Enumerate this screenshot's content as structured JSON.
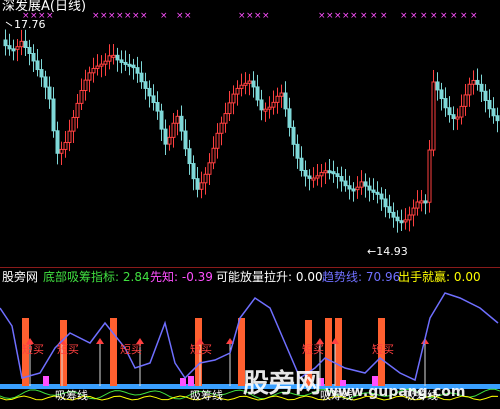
{
  "chart_title": "深发展A(日线)",
  "price": {
    "high_label": "17.76",
    "low_label": "←14.93",
    "markers_row": [
      "×",
      "×",
      "×",
      "×",
      "×",
      "×",
      "×",
      "×"
    ],
    "colors": {
      "up": "#ff4040",
      "down": "#7fd8d8",
      "marker": "#ff50ff"
    }
  },
  "indicator": {
    "watermark_left": "股旁网",
    "items": [
      {
        "label": "底部吸筹指标:",
        "value": "2.84",
        "color": "#40e040"
      },
      {
        "label": "先知:",
        "value": "-0.39",
        "color": "#ff50ff"
      },
      {
        "label": "可能放量拉升:",
        "value": "0.00",
        "color": "#ffffff"
      },
      {
        "label": "趋势线:",
        "value": "70.96",
        "color": "#7070ff"
      },
      {
        "label": "出手就赢:",
        "value": "0.00",
        "color": "#ffff00"
      }
    ],
    "signals_buy": [
      "短买",
      "短买",
      "短买",
      "短买",
      "短买",
      "短买"
    ],
    "signals_line": [
      "吸筹线",
      "吸筹线",
      "吸筹线",
      "吸筹线"
    ],
    "trend_color": "#6f6fff"
  },
  "watermark": {
    "cn": "股旁网",
    "url": "www.gupang.com"
  }
}
